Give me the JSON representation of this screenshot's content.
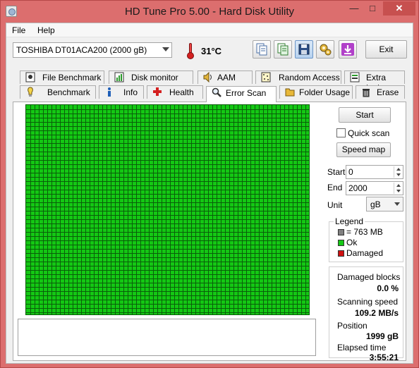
{
  "window": {
    "title": "HD Tune Pro 5.00 - Hard Disk Utility"
  },
  "menu": {
    "file": "File",
    "help": "Help"
  },
  "toolbar": {
    "drive": "TOSHIBA DT01ACA200 (2000 gB)",
    "temperature": "31°C",
    "exit_label": "Exit"
  },
  "tabs_top": [
    {
      "label": "File Benchmark",
      "icon": "file-benchmark-icon"
    },
    {
      "label": "Disk monitor",
      "icon": "disk-monitor-icon"
    },
    {
      "label": "AAM",
      "icon": "speaker-icon"
    },
    {
      "label": "Random Access",
      "icon": "random-access-icon"
    },
    {
      "label": "Extra tests",
      "icon": "extra-tests-icon"
    }
  ],
  "tabs_bottom": [
    {
      "label": "Benchmark",
      "icon": "benchmark-icon"
    },
    {
      "label": "Info",
      "icon": "info-icon"
    },
    {
      "label": "Health",
      "icon": "health-icon"
    },
    {
      "label": "Error Scan",
      "icon": "magnifier-icon",
      "selected": true
    },
    {
      "label": "Folder Usage",
      "icon": "folder-icon"
    },
    {
      "label": "Erase",
      "icon": "trash-icon"
    }
  ],
  "scan": {
    "start_button": "Start",
    "quick_scan_label": "Quick scan",
    "quick_scan_checked": false,
    "speed_map_button": "Speed map",
    "start_label": "Start",
    "start_value": "0",
    "end_label": "End",
    "end_value": "2000",
    "unit_label": "Unit",
    "unit_value": "gB",
    "legend_title": "Legend",
    "legend": [
      {
        "label": "= 763 MB",
        "color": "#808080"
      },
      {
        "label": "Ok",
        "color": "#14c814"
      },
      {
        "label": "Damaged",
        "color": "#d01010"
      }
    ],
    "damaged_blocks_label": "Damaged blocks",
    "damaged_blocks_value": "0.0 %",
    "scanning_speed_label": "Scanning speed",
    "scanning_speed_value": "109.2 MB/s",
    "position_label": "Position",
    "position_value": "1999 gB",
    "elapsed_label": "Elapsed time",
    "elapsed_value": "3:55:21",
    "log_text": ""
  },
  "colors": {
    "ok_block": "#14c814",
    "grid_line": "#0a5e0a"
  }
}
